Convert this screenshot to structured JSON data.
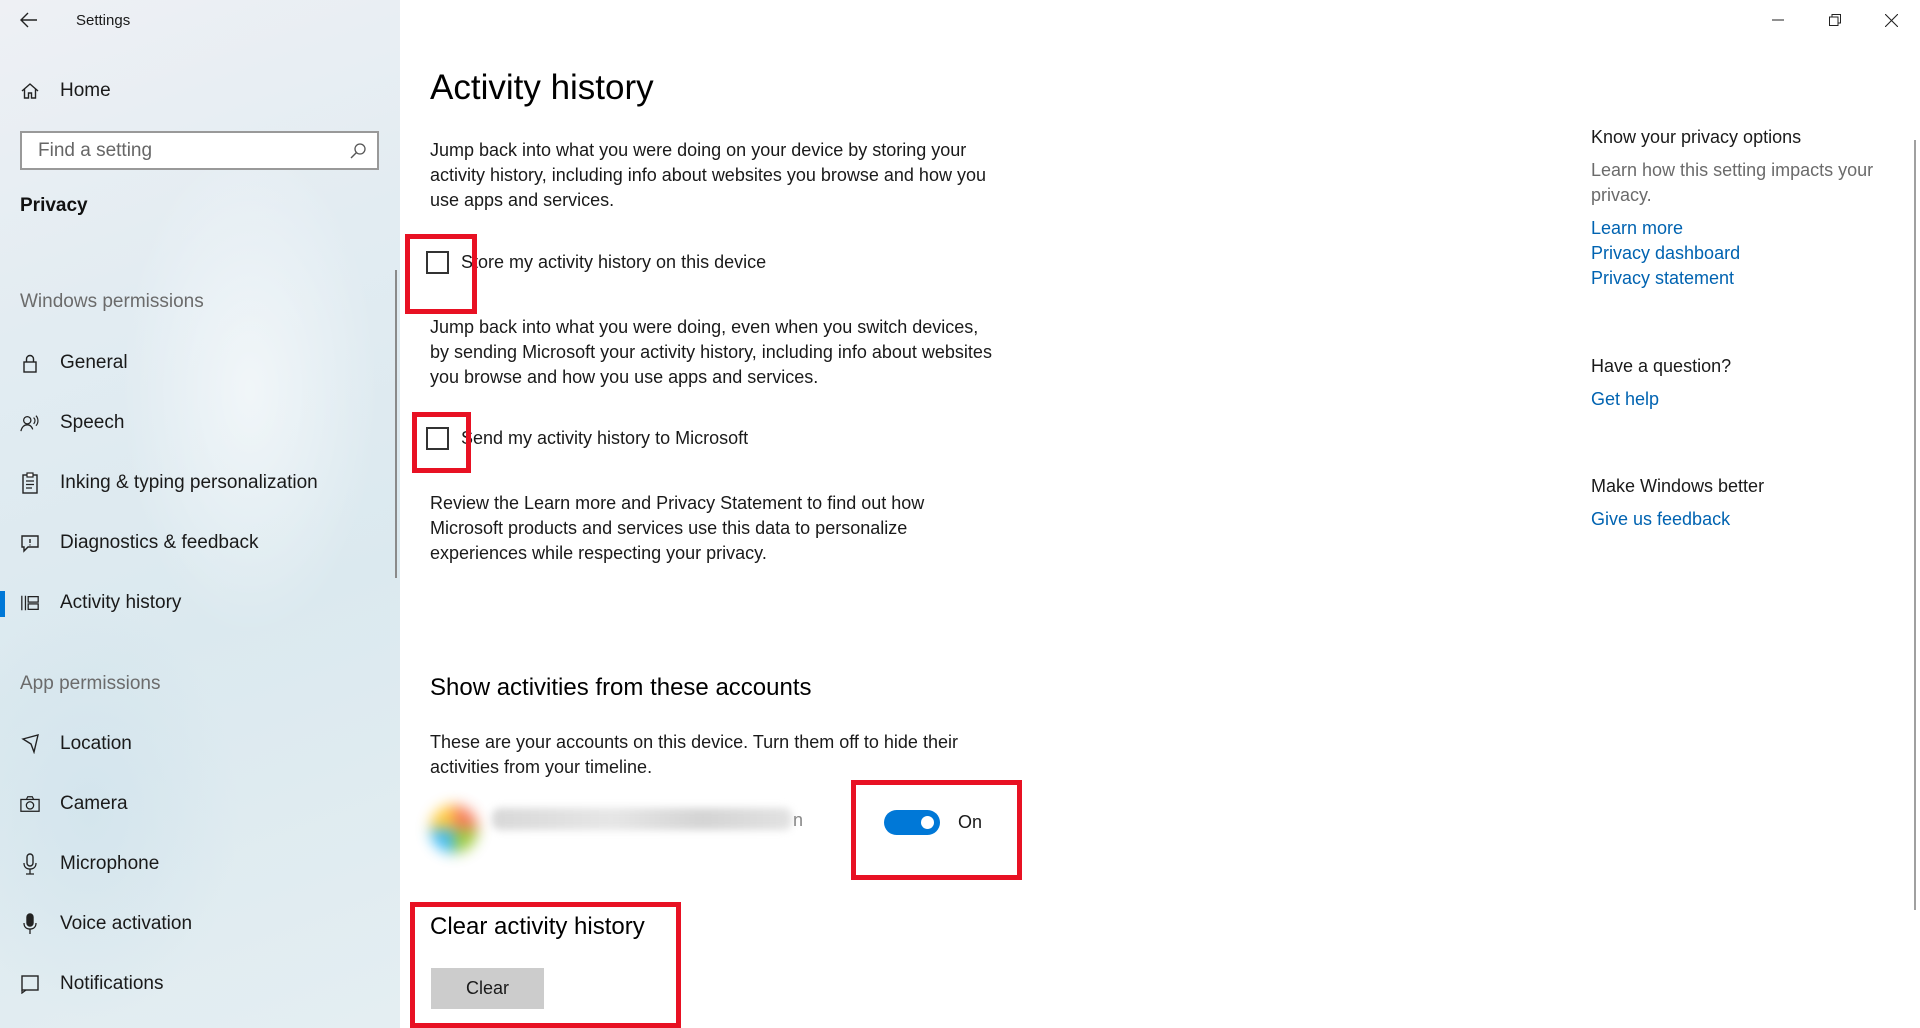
{
  "window": {
    "title": "Settings"
  },
  "sidebar": {
    "home_label": "Home",
    "search_placeholder": "Find a setting",
    "section_title": "Privacy",
    "group_windows_permissions": "Windows permissions",
    "windows_items": [
      {
        "label": "General",
        "icon": "lock-icon"
      },
      {
        "label": "Speech",
        "icon": "speech-icon"
      },
      {
        "label": "Inking & typing personalization",
        "icon": "clipboard-icon"
      },
      {
        "label": "Diagnostics & feedback",
        "icon": "feedback-icon"
      },
      {
        "label": "Activity history",
        "icon": "activity-icon",
        "selected": true
      }
    ],
    "group_app_permissions": "App permissions",
    "app_items": [
      {
        "label": "Location",
        "icon": "location-icon"
      },
      {
        "label": "Camera",
        "icon": "camera-icon"
      },
      {
        "label": "Microphone",
        "icon": "microphone-icon"
      },
      {
        "label": "Voice activation",
        "icon": "voice-icon"
      },
      {
        "label": "Notifications",
        "icon": "notifications-icon"
      }
    ]
  },
  "main": {
    "title": "Activity history",
    "intro": "Jump back into what you were doing on your device by storing your activity history, including info about websites you browse and how you use apps and services.",
    "store_checkbox_label": "Store my activity history on this device",
    "store_checked": false,
    "send_intro": "Jump back into what you were doing, even when you switch devices, by sending Microsoft your activity history, including info about websites you browse and how you use apps and services.",
    "send_checkbox_label": "Send my activity history to Microsoft",
    "send_checked": false,
    "review_text": "Review the Learn more and Privacy Statement to find out how Microsoft products and services use this data to personalize experiences while respecting your privacy.",
    "accounts_heading": "Show activities from these accounts",
    "accounts_desc": "These are your accounts on this device. Turn them off to hide their activities from your timeline.",
    "account_name_tail": "n",
    "account_toggle_label": "On",
    "account_toggle_on": true,
    "clear_heading": "Clear activity history",
    "clear_button": "Clear"
  },
  "right_panel": {
    "privacy_heading": "Know your privacy options",
    "privacy_text": "Learn how this setting impacts your privacy.",
    "links": [
      "Learn more",
      "Privacy dashboard",
      "Privacy statement"
    ],
    "question_heading": "Have a question?",
    "help_link": "Get help",
    "better_heading": "Make Windows better",
    "feedback_link": "Give us feedback"
  },
  "colors": {
    "accent": "#0078d7",
    "link": "#0063b1",
    "highlight": "#e81123"
  }
}
